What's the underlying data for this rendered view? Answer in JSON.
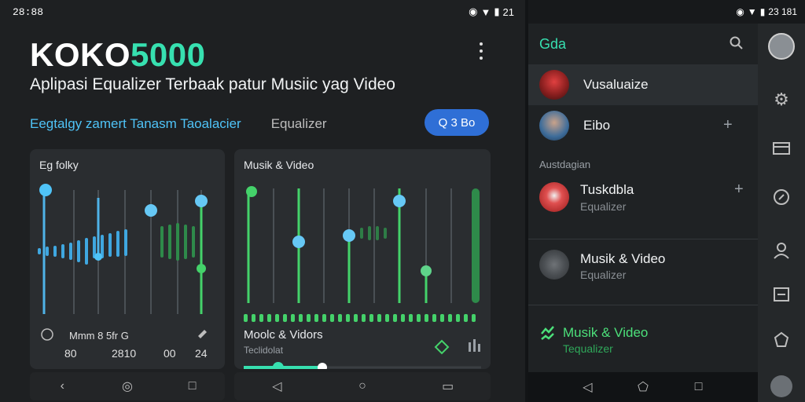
{
  "left": {
    "status": {
      "time": "28:88",
      "right": "21"
    },
    "title_prefix": "KOKO",
    "title_accent": "5000",
    "subtitle": "Aplipasi Equalizer Terbaak patur Musiic yag Video",
    "tabs": [
      {
        "label": "Eegtalgy zamert Tanasm Taoalacier"
      },
      {
        "label": "Equalizer"
      }
    ],
    "pill_button": "Q 3 Bo",
    "card_left": {
      "title": "Eg folky",
      "footer_label": "Mmm 8 5fr G",
      "footer_values": [
        "80",
        "2810",
        "00",
        "24"
      ]
    },
    "card_right": {
      "title": "Musik & Video",
      "footer_label": "Moolc & Vidors",
      "footer_sub": "Teclidolat",
      "slider_progress": 0.33
    }
  },
  "right": {
    "status": "23 181",
    "drawer_brand": "Gda",
    "items": [
      {
        "label": "Vusaluaize"
      },
      {
        "label": "Eibo"
      }
    ],
    "section": "Austdagian",
    "sub_items": [
      {
        "label": "Tuskdbla",
        "sub": "Equalizer"
      },
      {
        "label": "Musik & Video",
        "sub": "Equalizer"
      }
    ],
    "active_item": {
      "label": "Musik & Video",
      "sub": "Tequalizer"
    }
  },
  "colors": {
    "accent_teal": "#37e0b0",
    "accent_blue": "#4fc3f7",
    "accent_green": "#4ce07a",
    "pill_blue": "#2f6fd6"
  }
}
